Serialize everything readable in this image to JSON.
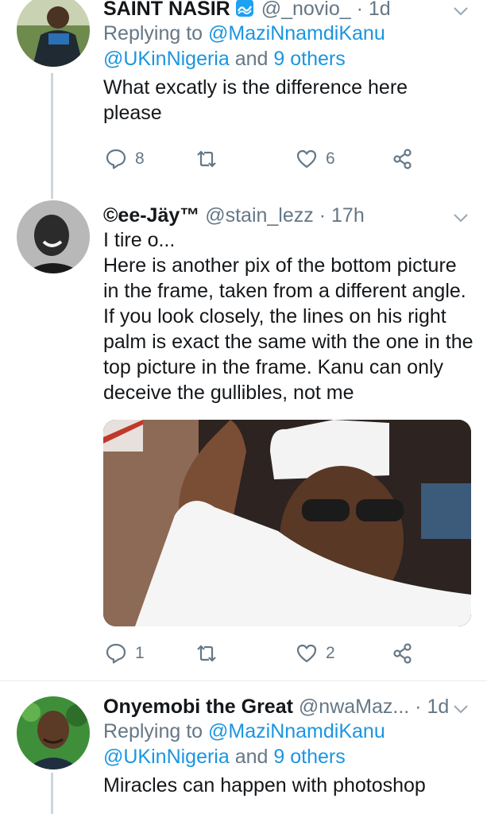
{
  "tweets": [
    {
      "name": "SAINT NASIR",
      "handle": "@_novio_",
      "dot": "·",
      "time": "1d",
      "reply_prefix": "Replying to",
      "reply_mention_1": "@MaziNnamdiKanu",
      "reply_mention_2": "@UKinNigeria",
      "reply_and": "and",
      "reply_others": "9 others",
      "text": "What excatly is the difference here please",
      "replies": "8",
      "retweets": "",
      "likes": "6"
    },
    {
      "name": "©ee-Jäy™",
      "handle": "@stain_lezz",
      "dot": "·",
      "time": "17h",
      "text_lines": [
        "I tire o...",
        "Here is another pix of the bottom picture in the frame, taken from a different angle. If you look closely, the lines on his right palm is exact the same with the one in the top picture in the frame. Kanu can only deceive the gullibles, not me"
      ],
      "replies": "1",
      "retweets": "",
      "likes": "2"
    },
    {
      "name": "Onyemobi the Great",
      "handle": "@nwaMaz...",
      "dot": "·",
      "time": "1d",
      "reply_prefix": "Replying to",
      "reply_mention_1": "@MaziNnamdiKanu",
      "reply_mention_2": "@UKinNigeria",
      "reply_and": "and",
      "reply_others": "9 others",
      "text": "Miracles can happen with photoshop"
    }
  ],
  "colors": {
    "link": "#1b95e0",
    "secondary": "#657786",
    "thread_line": "#ccd6dd",
    "divider": "#e6ecf0"
  },
  "icons": [
    "reply-icon",
    "retweet-icon",
    "like-icon",
    "share-icon",
    "chevron-down-icon",
    "verified-wave-icon"
  ]
}
